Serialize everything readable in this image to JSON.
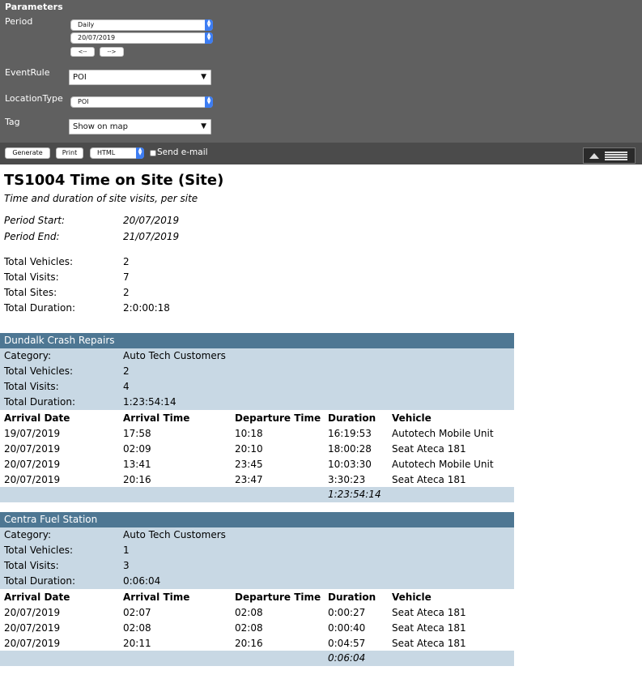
{
  "parameters": {
    "title": "Parameters",
    "period_label": "Period",
    "period_value": "Daily",
    "date_value": "20/07/2019",
    "prev_label": "<--",
    "next_label": "-->",
    "eventrule_label": "EventRule",
    "eventrule_value": "POI",
    "locationtype_label": "LocationType",
    "locationtype_value": "POI",
    "tag_label": "Tag",
    "tag_value": "Show on map"
  },
  "toolbar": {
    "generate_label": "Generate",
    "print_label": "Print",
    "format_value": "HTML",
    "send_email_label": "Send e-mail"
  },
  "report": {
    "title": "TS1004 Time on Site (Site)",
    "subtitle": "Time and duration of site visits, per site",
    "period_start_label": "Period Start:",
    "period_start": "20/07/2019",
    "period_end_label": "Period End:",
    "period_end": "21/07/2019",
    "summary": [
      {
        "label": "Total Vehicles:",
        "value": "2"
      },
      {
        "label": "Total Visits:",
        "value": "7"
      },
      {
        "label": "Total Sites:",
        "value": "2"
      },
      {
        "label": "Total Duration:",
        "value": "2:0:00:18"
      }
    ],
    "columns": [
      "Arrival Date",
      "Arrival Time",
      "Departure Time",
      "Duration",
      "Vehicle"
    ],
    "sites": [
      {
        "name": "Dundalk Crash Repairs",
        "meta": [
          {
            "label": "Category:",
            "value": "Auto Tech Customers"
          },
          {
            "label": "Total Vehicles:",
            "value": "2"
          },
          {
            "label": "Total Visits:",
            "value": "4"
          },
          {
            "label": "Total Duration:",
            "value": "1:23:54:14"
          }
        ],
        "rows": [
          [
            "19/07/2019",
            "17:58",
            "10:18",
            "16:19:53",
            "Autotech Mobile Unit"
          ],
          [
            "20/07/2019",
            "02:09",
            "20:10",
            "18:00:28",
            "Seat Ateca 181"
          ],
          [
            "20/07/2019",
            "13:41",
            "23:45",
            "10:03:30",
            "Autotech Mobile Unit"
          ],
          [
            "20/07/2019",
            "20:16",
            "23:47",
            "3:30:23",
            "Seat Ateca 181"
          ]
        ],
        "total": "1:23:54:14"
      },
      {
        "name": "Centra Fuel Station",
        "meta": [
          {
            "label": "Category:",
            "value": "Auto Tech Customers"
          },
          {
            "label": "Total Vehicles:",
            "value": "1"
          },
          {
            "label": "Total Visits:",
            "value": "3"
          },
          {
            "label": "Total Duration:",
            "value": "0:06:04"
          }
        ],
        "rows": [
          [
            "20/07/2019",
            "02:07",
            "02:08",
            "0:00:27",
            "Seat Ateca 181"
          ],
          [
            "20/07/2019",
            "02:08",
            "02:08",
            "0:00:40",
            "Seat Ateca 181"
          ],
          [
            "20/07/2019",
            "20:11",
            "20:16",
            "0:04:57",
            "Seat Ateca 181"
          ]
        ],
        "total": "0:06:04"
      }
    ]
  }
}
